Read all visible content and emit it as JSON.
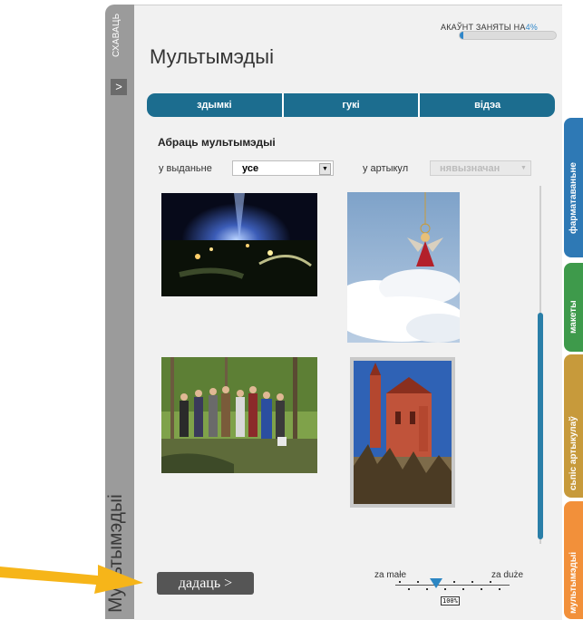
{
  "sidebar": {
    "hide_label": "СХАВАЦЬ",
    "toggle_glyph": ">",
    "section_title": "Мультымэдыі"
  },
  "header": {
    "title": "Мультымэдыі"
  },
  "quota": {
    "label": "АКАЎНТ ЗАНЯТЫ НА",
    "percent": "4%",
    "fraction": 0.04
  },
  "tabs": [
    {
      "label": "здымкі"
    },
    {
      "label": "гукі"
    },
    {
      "label": "відэа"
    }
  ],
  "filters": {
    "section_title": "Абраць мультымэдыі",
    "edition_label": "у выданьне",
    "edition_value": "усе",
    "article_label": "у артыкул",
    "article_value": "нявызначан"
  },
  "gallery": [
    {
      "name": "photo-night-lights"
    },
    {
      "name": "photo-angel-ornament"
    },
    {
      "name": "photo-group-forest"
    },
    {
      "name": "photo-red-church"
    }
  ],
  "actions": {
    "add_label": "дадаць >"
  },
  "zoom": {
    "min_label": "za małe",
    "max_label": "za duże",
    "value": "100%"
  },
  "side_tabs": [
    {
      "label": "фарматаваньне",
      "color": "#2e79b5"
    },
    {
      "label": "макеты",
      "color": "#3e9a4b"
    },
    {
      "label": "сьпіс артыкулаў",
      "color": "#c79a3b"
    },
    {
      "label": "мультымэдыі",
      "color": "#f2903a"
    }
  ],
  "colors": {
    "accent": "#1c6d8f",
    "arrow": "#f6b519"
  }
}
